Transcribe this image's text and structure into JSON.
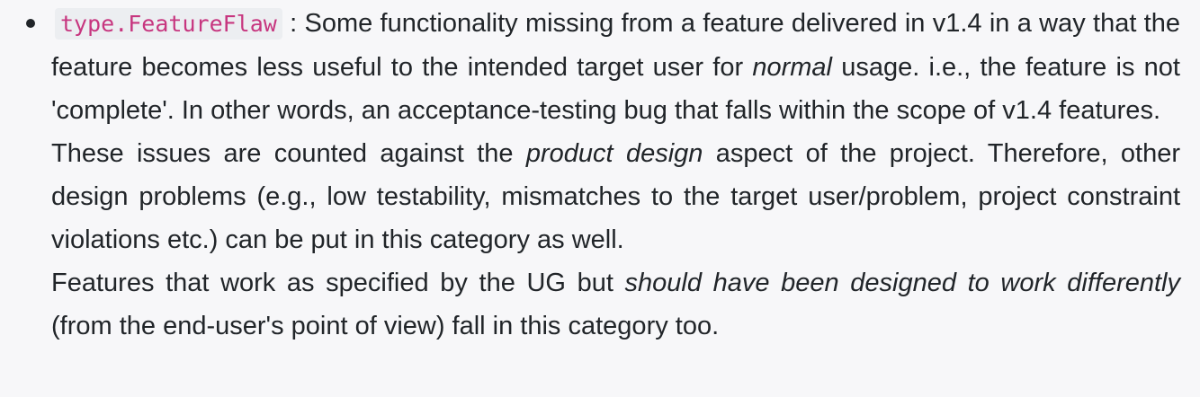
{
  "item": {
    "code": "type.FeatureFlaw",
    "p1": {
      "before_em": " : Some functionality missing from a feature delivered in v1.4 in a way that the feature becomes less useful to the intended target user for ",
      "em": "normal",
      "after_em": " usage. i.e., the feature is not 'complete'. In other words, an acceptance-testing bug that falls within the scope of v1.4 features."
    },
    "p2": {
      "before_em": "These issues are counted against the ",
      "em": "product design",
      "after_em": " aspect of the project. Therefore, other design problems (e.g., low testability, mismatches to the target user/problem, project constraint violations etc.) can be put in this category as well."
    },
    "p3": {
      "before_em": "Features that work as specified by the UG but ",
      "em": "should have been designed to work differently",
      "after_em": " (from the end-user's point of view) fall in this category too."
    }
  }
}
